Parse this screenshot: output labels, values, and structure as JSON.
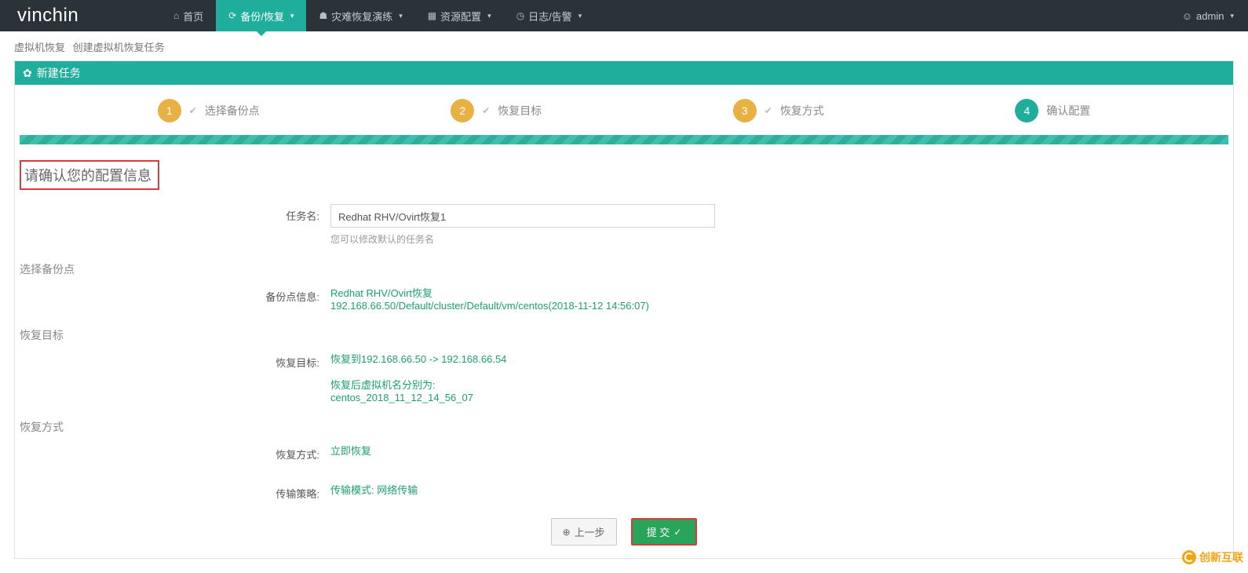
{
  "brand": "vinchin",
  "nav": {
    "home": "首页",
    "backup": "备份/恢复",
    "dr": "灾难恢复演练",
    "resource": "资源配置",
    "log": "日志/告警"
  },
  "user": {
    "name": "admin"
  },
  "breadcrumb": {
    "a": "虚拟机恢复",
    "b": "创建虚拟机恢复任务"
  },
  "panel_title": "新建任务",
  "steps": {
    "s1": "选择备份点",
    "s2": "恢复目标",
    "s3": "恢复方式",
    "s4": "确认配置"
  },
  "confirm_title": "请确认您的配置信息",
  "task_name": {
    "label": "任务名:",
    "value": "Redhat RHV/Ovirt恢复1",
    "hint": "您可以修改默认的任务名"
  },
  "sections": {
    "backup_point": {
      "title": "选择备份点",
      "label": "备份点信息:",
      "line1": "Redhat RHV/Ovirt恢复",
      "line2": "192.168.66.50/Default/cluster/Default/vm/centos(2018-11-12 14:56:07)"
    },
    "target": {
      "title": "恢复目标",
      "label": "恢复目标:",
      "line1": "恢复到192.168.66.50 -> 192.168.66.54",
      "line2": "恢复后虚拟机名分别为:",
      "line3": "centos_2018_11_12_14_56_07"
    },
    "mode": {
      "title": "恢复方式",
      "label": "恢复方式:",
      "value": "立即恢复",
      "policy_label": "传输策略:",
      "policy_value": "传输模式: 网络传输"
    }
  },
  "buttons": {
    "prev": "上一步",
    "submit": "提 交"
  },
  "watermark": "创新互联"
}
